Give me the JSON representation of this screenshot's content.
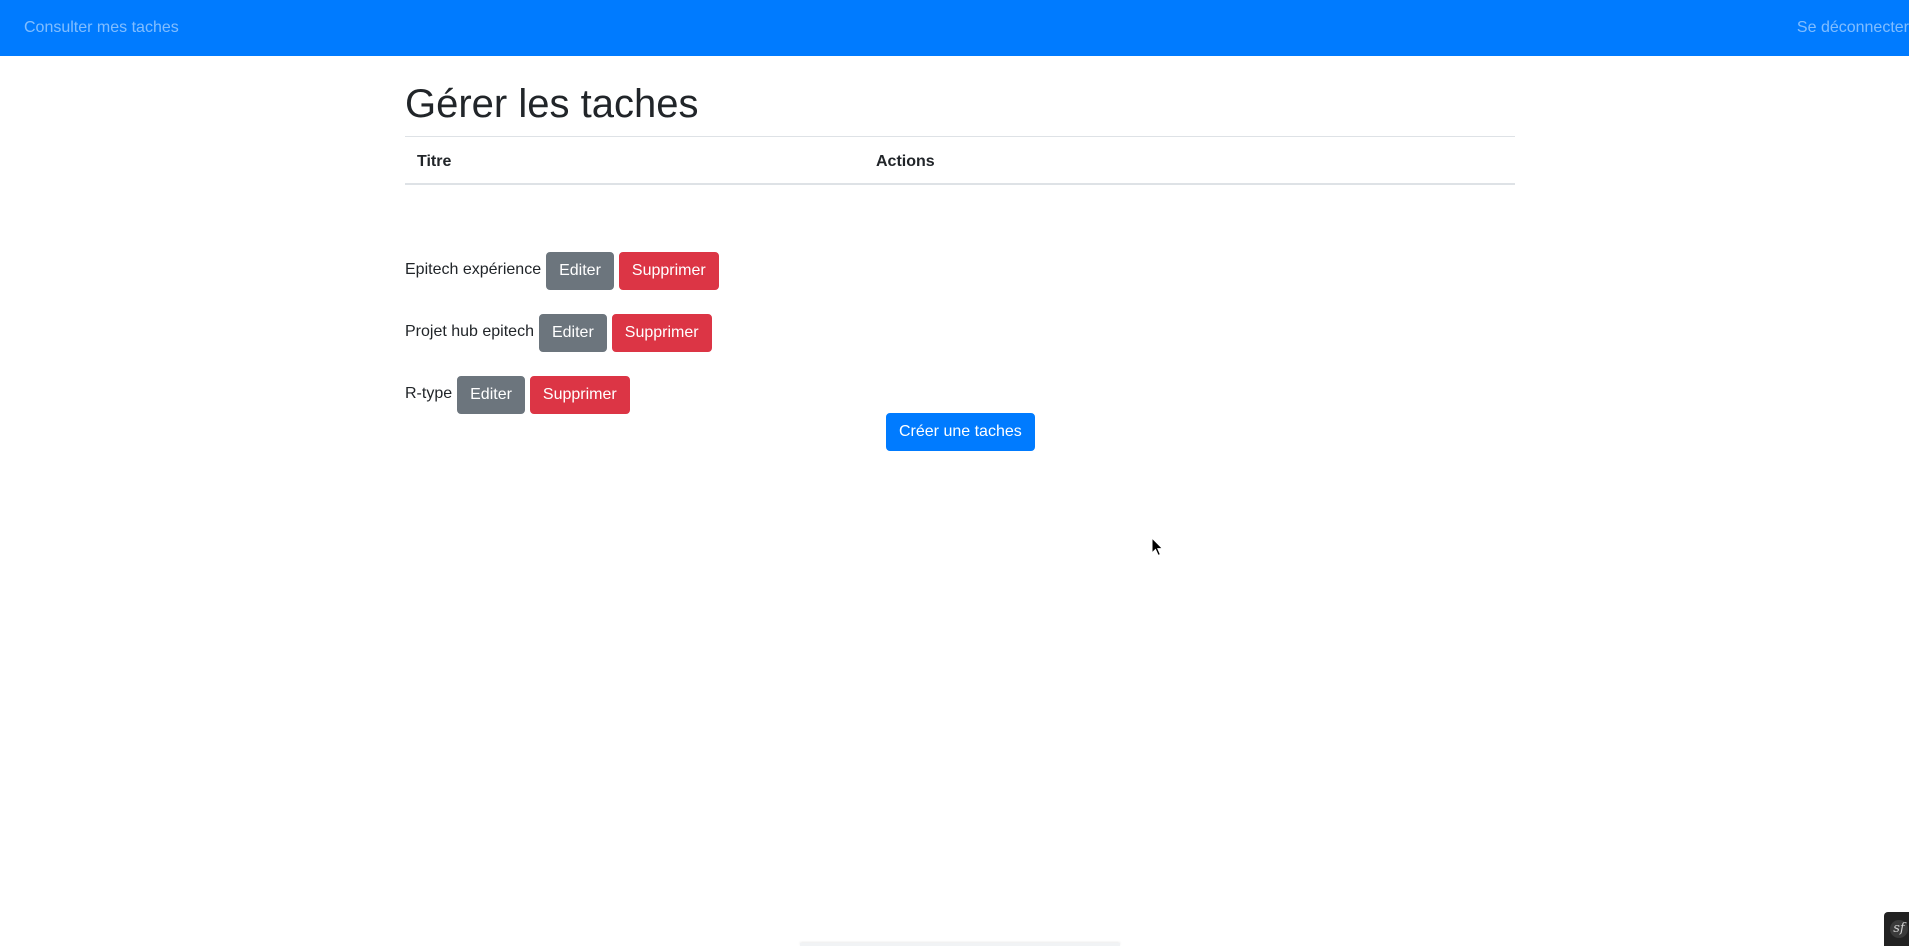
{
  "navbar": {
    "left_link": "Consulter mes taches",
    "right_link": "Se déconnecter"
  },
  "main": {
    "title": "Gérer les taches",
    "table_headers": [
      "Titre",
      "Actions"
    ],
    "tasks": [
      {
        "title": "Epitech expérience",
        "edit_label": "Editer",
        "delete_label": "Supprimer"
      },
      {
        "title": "Projet hub epitech",
        "edit_label": "Editer",
        "delete_label": "Supprimer"
      },
      {
        "title": "R-type",
        "edit_label": "Editer",
        "delete_label": "Supprimer"
      }
    ],
    "create_label": "Créer une taches"
  },
  "debug_toolbar": {
    "logo_glyph": "sf"
  },
  "colors": {
    "navbar": "#007bff",
    "primary": "#007bff",
    "secondary": "#6c757d",
    "danger": "#dc3545"
  },
  "icons": [
    "mouse-cursor-icon",
    "symfony-logo-icon"
  ]
}
